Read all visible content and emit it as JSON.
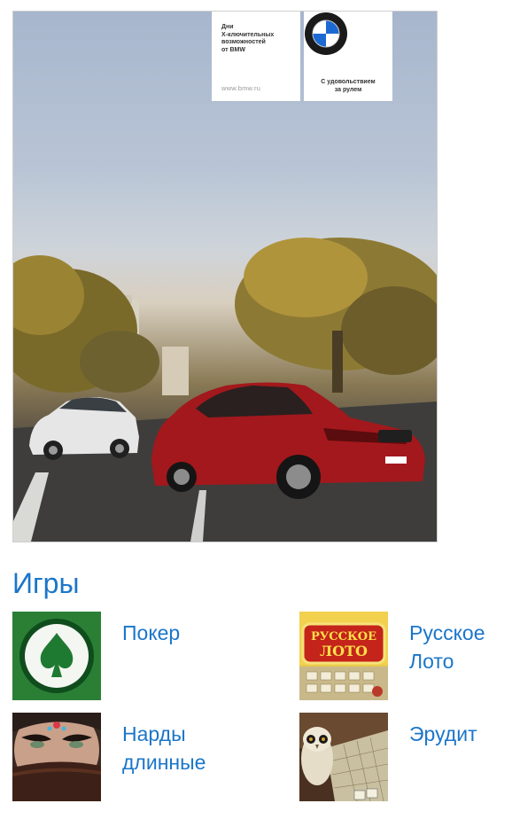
{
  "ad": {
    "promo_text": "Дни\nX-ключительных\nвозможностей\nот BMW",
    "url": "www.bmw.ru",
    "brand": "BMW",
    "slogan": "С удовольствием\nза рулем",
    "colors": {
      "car_red": "#a3181c",
      "car_white": "#e8e8e8",
      "bmw_blue": "#1c69d4"
    }
  },
  "games_section": {
    "title": "Игры",
    "items": [
      {
        "name": "Покер",
        "icon": "spade-icon"
      },
      {
        "name": "Русское\nЛото",
        "icon": "russian-loto-icon",
        "icon_text": "РУССКОЕ ЛОТО"
      },
      {
        "name": "Нарды\nдлинные",
        "icon": "woman-face-icon"
      },
      {
        "name": "Эрудит",
        "icon": "owl-icon"
      }
    ],
    "link_color": "#1b76c9"
  }
}
